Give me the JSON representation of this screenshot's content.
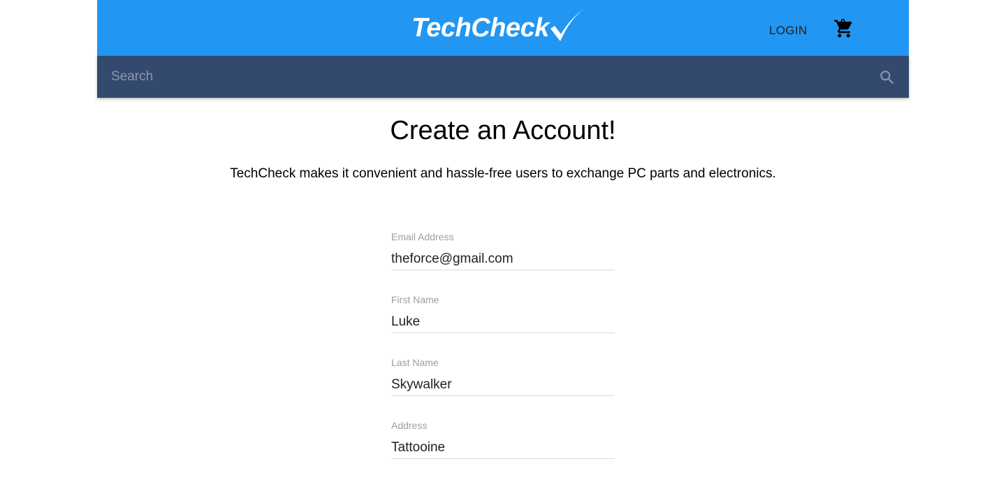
{
  "header": {
    "logo_text": "TechCheck",
    "login_label": "LOGIN",
    "cart_count": "0",
    "brand_color": "#2196f3"
  },
  "search": {
    "placeholder": "Search",
    "icon": "search-icon",
    "bar_color": "#34496e"
  },
  "main": {
    "title": "Create an Account!",
    "subtitle": "TechCheck makes it convenient and hassle-free users to exchange PC parts and electronics."
  },
  "form": {
    "fields": [
      {
        "label": "Email Address",
        "value": "theforce@gmail.com"
      },
      {
        "label": "First Name",
        "value": "Luke"
      },
      {
        "label": "Last Name",
        "value": "Skywalker"
      },
      {
        "label": "Address",
        "value": "Tattooine"
      }
    ]
  }
}
